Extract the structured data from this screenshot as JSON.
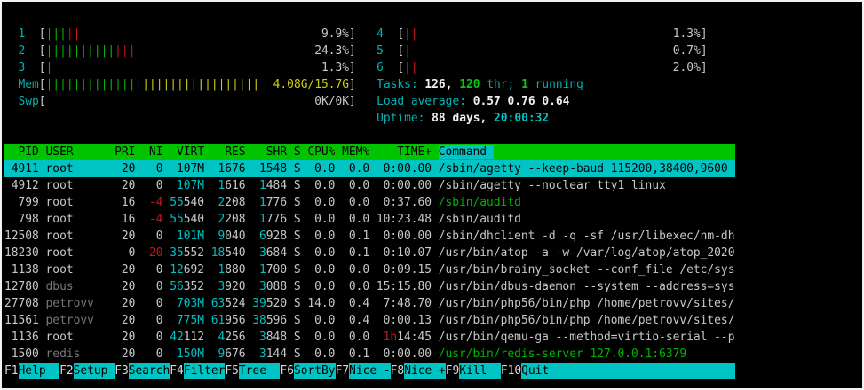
{
  "colors": {
    "background": "#000000",
    "accent_cyan": "#00b3b3",
    "selection_cyan": "#00c3c3",
    "header_green": "#00c400",
    "bar_green": "#00b400",
    "bar_red": "#cc1515",
    "bar_yellow": "#cdcd12",
    "bar_blue": "#3333cc",
    "text": "#c8c8c8",
    "dim_user": "#777777"
  },
  "meters": {
    "left": [
      {
        "name": "cpu-meter-1",
        "label": "1",
        "bars": [
          [
            "c-green",
            3
          ],
          [
            "c-red",
            2
          ]
        ],
        "value": "9.9%"
      },
      {
        "name": "cpu-meter-2",
        "label": "2",
        "bars": [
          [
            "c-green",
            10
          ],
          [
            "c-red",
            3
          ]
        ],
        "value": "24.3%"
      },
      {
        "name": "cpu-meter-3",
        "label": "3",
        "bars": [
          [
            "c-green",
            1
          ]
        ],
        "value": "1.3%"
      },
      {
        "name": "memory-meter",
        "label": "Mem",
        "bars": [
          [
            "c-green",
            13
          ],
          [
            "c-blue",
            1
          ],
          [
            "c-yellow",
            17
          ]
        ],
        "value": "4.08G/15.7G",
        "value_class": "c-yellow"
      },
      {
        "name": "swap-meter",
        "label": "Swp",
        "bars": [],
        "value": "0K/0K"
      }
    ],
    "right": [
      {
        "name": "cpu-meter-4",
        "label": "4",
        "bars": [
          [
            "c-green",
            1
          ],
          [
            "c-red",
            1
          ]
        ],
        "value": "1.3%"
      },
      {
        "name": "cpu-meter-5",
        "label": "5",
        "bars": [
          [
            "c-red",
            1
          ]
        ],
        "value": "0.7%"
      },
      {
        "name": "cpu-meter-6",
        "label": "6",
        "bars": [
          [
            "c-green",
            1
          ],
          [
            "c-red",
            1
          ]
        ],
        "value": "2.0%"
      }
    ]
  },
  "summary": {
    "tasks": {
      "name": "tasks-summary",
      "segments": [
        {
          "t": "Tasks: ",
          "c": "c-cyan"
        },
        {
          "t": "126, ",
          "c": "c-white"
        },
        {
          "t": "120",
          "c": "c-bgreen"
        },
        {
          "t": " thr; ",
          "c": "c-cyan"
        },
        {
          "t": "1",
          "c": "c-bgreen"
        },
        {
          "t": " running",
          "c": "c-cyan"
        }
      ]
    },
    "load": {
      "name": "load-average",
      "segments": [
        {
          "t": "Load average: ",
          "c": "c-cyan"
        },
        {
          "t": "0.57 ",
          "c": "c-white"
        },
        {
          "t": "0.76 ",
          "c": "c-white"
        },
        {
          "t": "0.64",
          "c": "c-white"
        }
      ]
    },
    "uptime": {
      "name": "uptime",
      "segments": [
        {
          "t": "Uptime: ",
          "c": "c-cyan"
        },
        {
          "t": "88 days, ",
          "c": "c-white"
        },
        {
          "t": "20:00:32",
          "c": "c-bcyan"
        }
      ]
    }
  },
  "table": {
    "headers": [
      {
        "id": "pid",
        "label": "PID"
      },
      {
        "id": "user",
        "label": "USER"
      },
      {
        "id": "pri",
        "label": "PRI"
      },
      {
        "id": "ni",
        "label": "NI"
      },
      {
        "id": "virt",
        "label": "VIRT"
      },
      {
        "id": "res",
        "label": "RES"
      },
      {
        "id": "shr",
        "label": "SHR"
      },
      {
        "id": "s",
        "label": "S"
      },
      {
        "id": "cpu",
        "label": "CPU%"
      },
      {
        "id": "mem",
        "label": "MEM%"
      },
      {
        "id": "time",
        "label": "TIME+"
      },
      {
        "id": "cmd",
        "label": "Command",
        "sort": true
      }
    ],
    "rows": [
      {
        "pid": "4911",
        "user": "root",
        "dim": false,
        "pri": "20",
        "ni": "0",
        "ni_red": false,
        "virt": [
          "107M",
          ""
        ],
        "res": [
          "1",
          "676"
        ],
        "shr": [
          "1",
          "548"
        ],
        "s": "S",
        "cpu": "0.0",
        "mem": "0.0",
        "time": [
          "",
          "0:00.00"
        ],
        "cmd": "/sbin/agetty --keep-baud 115200,38400,9600",
        "cmd_green": false,
        "selected": true
      },
      {
        "pid": "4912",
        "user": "root",
        "dim": false,
        "pri": "20",
        "ni": "0",
        "ni_red": false,
        "virt": [
          "107M",
          ""
        ],
        "res": [
          "1",
          "616"
        ],
        "shr": [
          "1",
          "484"
        ],
        "s": "S",
        "cpu": "0.0",
        "mem": "0.0",
        "time": [
          "",
          "0:00.00"
        ],
        "cmd": "/sbin/agetty --noclear tty1 linux",
        "cmd_green": false,
        "selected": false
      },
      {
        "pid": "799",
        "user": "root",
        "dim": false,
        "pri": "16",
        "ni": "-4",
        "ni_red": true,
        "virt": [
          "55",
          "540"
        ],
        "res": [
          "2",
          "208"
        ],
        "shr": [
          "1",
          "776"
        ],
        "s": "S",
        "cpu": "0.0",
        "mem": "0.0",
        "time": [
          "",
          "0:37.60"
        ],
        "cmd": "/sbin/auditd",
        "cmd_green": true,
        "selected": false
      },
      {
        "pid": "798",
        "user": "root",
        "dim": false,
        "pri": "16",
        "ni": "-4",
        "ni_red": true,
        "virt": [
          "55",
          "540"
        ],
        "res": [
          "2",
          "208"
        ],
        "shr": [
          "1",
          "776"
        ],
        "s": "S",
        "cpu": "0.0",
        "mem": "0.0",
        "time": [
          "",
          "10:23.48"
        ],
        "cmd": "/sbin/auditd",
        "cmd_green": false,
        "selected": false
      },
      {
        "pid": "12508",
        "user": "root",
        "dim": false,
        "pri": "20",
        "ni": "0",
        "ni_red": false,
        "virt": [
          "101M",
          ""
        ],
        "res": [
          "9",
          "040"
        ],
        "shr": [
          "6",
          "928"
        ],
        "s": "S",
        "cpu": "0.0",
        "mem": "0.1",
        "time": [
          "",
          "0:00.00"
        ],
        "cmd": "/sbin/dhclient -d -q -sf /usr/libexec/nm-dh",
        "cmd_green": false,
        "selected": false
      },
      {
        "pid": "18230",
        "user": "root",
        "dim": false,
        "pri": "0",
        "ni": "-20",
        "ni_red": true,
        "virt": [
          "35",
          "552"
        ],
        "res": [
          "18",
          "540"
        ],
        "shr": [
          "3",
          "684"
        ],
        "s": "S",
        "cpu": "0.0",
        "mem": "0.1",
        "time": [
          "",
          "0:10.07"
        ],
        "cmd": "/usr/bin/atop -a -w /var/log/atop/atop_2020",
        "cmd_green": false,
        "selected": false
      },
      {
        "pid": "1138",
        "user": "root",
        "dim": false,
        "pri": "20",
        "ni": "0",
        "ni_red": false,
        "virt": [
          "12",
          "692"
        ],
        "res": [
          "1",
          "880"
        ],
        "shr": [
          "1",
          "700"
        ],
        "s": "S",
        "cpu": "0.0",
        "mem": "0.0",
        "time": [
          "",
          "0:09.15"
        ],
        "cmd": "/usr/bin/brainy_socket --conf_file /etc/sys",
        "cmd_green": false,
        "selected": false
      },
      {
        "pid": "12780",
        "user": "dbus",
        "dim": true,
        "pri": "20",
        "ni": "0",
        "ni_red": false,
        "virt": [
          "56",
          "352"
        ],
        "res": [
          "3",
          "920"
        ],
        "shr": [
          "3",
          "088"
        ],
        "s": "S",
        "cpu": "0.0",
        "mem": "0.0",
        "time": [
          "",
          "15:15.80"
        ],
        "cmd": "/usr/bin/dbus-daemon --system --address=sys",
        "cmd_green": false,
        "selected": false
      },
      {
        "pid": "27708",
        "user": "petrovv",
        "dim": true,
        "pri": "20",
        "ni": "0",
        "ni_red": false,
        "virt": [
          "703M",
          ""
        ],
        "res": [
          "63",
          "524"
        ],
        "shr": [
          "39",
          "520"
        ],
        "s": "S",
        "cpu": "14.0",
        "mem": "0.4",
        "time": [
          "",
          "7:48.70"
        ],
        "cmd": "/usr/bin/php56/bin/php /home/petrovv/sites/",
        "cmd_green": false,
        "selected": false
      },
      {
        "pid": "11561",
        "user": "petrovv",
        "dim": true,
        "pri": "20",
        "ni": "0",
        "ni_red": false,
        "virt": [
          "775M",
          ""
        ],
        "res": [
          "61",
          "956"
        ],
        "shr": [
          "38",
          "596"
        ],
        "s": "S",
        "cpu": "0.0",
        "mem": "0.4",
        "time": [
          "",
          "0:00.13"
        ],
        "cmd": "/usr/bin/php56/bin/php /home/petrovv/sites/",
        "cmd_green": false,
        "selected": false
      },
      {
        "pid": "1136",
        "user": "root",
        "dim": false,
        "pri": "20",
        "ni": "0",
        "ni_red": false,
        "virt": [
          "42",
          "112"
        ],
        "res": [
          "4",
          "256"
        ],
        "shr": [
          "3",
          "848"
        ],
        "s": "S",
        "cpu": "0.0",
        "mem": "0.0",
        "time": [
          "1h",
          "14:45"
        ],
        "cmd": "/usr/bin/qemu-ga --method=virtio-serial --p",
        "cmd_green": false,
        "selected": false
      },
      {
        "pid": "1500",
        "user": "redis",
        "dim": true,
        "pri": "20",
        "ni": "0",
        "ni_red": false,
        "virt": [
          "150M",
          ""
        ],
        "res": [
          "9",
          "676"
        ],
        "shr": [
          "3",
          "144"
        ],
        "s": "S",
        "cpu": "0.0",
        "mem": "0.1",
        "time": [
          "",
          "0:00.00"
        ],
        "cmd": "/usr/bin/redis-server 127.0.0.1:6379",
        "cmd_green": true,
        "selected": false
      }
    ]
  },
  "fbar": [
    {
      "key": "F1",
      "label": "Help"
    },
    {
      "key": "F2",
      "label": "Setup"
    },
    {
      "key": "F3",
      "label": "Search"
    },
    {
      "key": "F4",
      "label": "Filter"
    },
    {
      "key": "F5",
      "label": "Tree"
    },
    {
      "key": "F6",
      "label": "SortBy"
    },
    {
      "key": "F7",
      "label": "Nice -"
    },
    {
      "key": "F8",
      "label": "Nice +"
    },
    {
      "key": "F9",
      "label": "Kill"
    },
    {
      "key": "F10",
      "label": "Quit"
    }
  ]
}
